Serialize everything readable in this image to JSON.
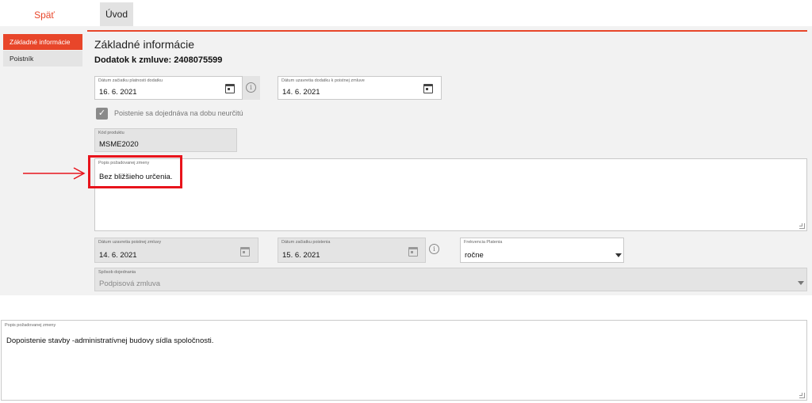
{
  "nav": {
    "back_label": "Späť",
    "tab_label": "Úvod"
  },
  "sidebar": {
    "items": [
      {
        "label": "Základné informácie",
        "active": true
      },
      {
        "label": "Poistník",
        "active": false
      }
    ]
  },
  "section": {
    "title": "Základné informácie",
    "subtitle": "Dodatok k zmluve: 2408075599"
  },
  "fields": {
    "start_date": {
      "label": "Dátum začiatku platnosti dodatku",
      "value": "16. 6. 2021"
    },
    "concluded_date": {
      "label": "Dátum uzavretia dodatku k poistnej zmluve",
      "value": "14. 6. 2021"
    },
    "indefinite": {
      "label": "Poistenie sa dojednáva na dobu neurčitú",
      "checked": true
    },
    "product_code": {
      "label": "Kód produktu",
      "value": "MSME2020"
    },
    "change_desc": {
      "label": "Popis požadovanej zmeny",
      "value": "Bez bližšieho určenia."
    },
    "contract_date": {
      "label": "Dátum uzavretia poistnej zmluvy",
      "value": "14. 6. 2021"
    },
    "insurance_start": {
      "label": "Dátum začiatku poistenia",
      "value": "15. 6. 2021"
    },
    "payment_frequency": {
      "label": "Frekvencia Platenia",
      "value": "ročne"
    },
    "agreement_method": {
      "label": "Spôsob dojednania",
      "value": "Podpisová zmluva"
    }
  },
  "bottom": {
    "label": "Popis požadovanej zmeny",
    "value": "Dopoistenie stavby -administratívnej budovy sídla spoločnosti."
  },
  "icons": {
    "calendar": "calendar-icon",
    "info": "info-icon",
    "check": "check-icon",
    "dropdown": "chevron-down-icon",
    "arrow": "arrow-right-icon"
  },
  "colors": {
    "accent": "#e8462a",
    "highlight": "#e8141c",
    "panel_bg": "#f2f2f2",
    "disabled_bg": "#e4e4e4"
  }
}
